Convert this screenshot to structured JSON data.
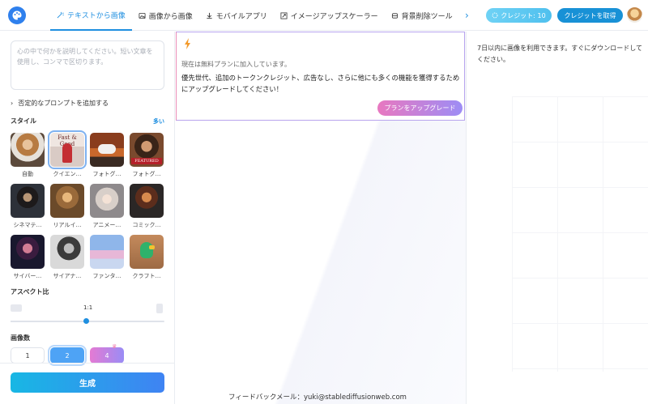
{
  "header": {
    "nav": [
      {
        "label": "テキストから画像",
        "icon": "magic-wand-icon",
        "active": true
      },
      {
        "label": "画像から画像",
        "icon": "image-icon",
        "active": false
      },
      {
        "label": "モバイルアプリ",
        "icon": "download-icon",
        "active": false
      },
      {
        "label": "イメージアップスケーラー",
        "icon": "upscale-icon",
        "active": false
      },
      {
        "label": "背景削除ツール",
        "icon": "layers-icon",
        "active": false
      }
    ],
    "credits": "クレジット: 10",
    "get_credits": "クレジットを取得"
  },
  "left": {
    "prompt_placeholder": "心の中で何かを説明してください。短い文章を使用し、コンマで区切ります。",
    "negative_prompt": "否定的なプロンプトを追加する",
    "style_title": "スタイル",
    "more": "多い",
    "styles": [
      {
        "label": "自動"
      },
      {
        "label": "クイエン…",
        "overlay": "Fast & Good",
        "selected": true
      },
      {
        "label": "フォトグ…"
      },
      {
        "label": "フォトグ…",
        "overlay": "FEATURED"
      },
      {
        "label": "シネマテ…"
      },
      {
        "label": "リアルイ…"
      },
      {
        "label": "アニメー…"
      },
      {
        "label": "コミック…"
      },
      {
        "label": "サイバー…"
      },
      {
        "label": "サイアナ…"
      },
      {
        "label": "ファンタ…"
      },
      {
        "label": "クラフト…"
      }
    ],
    "aspect_title": "アスペクト比",
    "aspect_value": "1:1",
    "aspect_slider_fraction": 0.49,
    "count_title": "画像数",
    "counts": [
      "1",
      "2",
      "4"
    ],
    "selected_count": "2",
    "generate": "生成"
  },
  "middle": {
    "plan_note": "現在は無料プランに加入しています。",
    "upgrade_message": "優先世代、追加のトークンクレジット、広告なし、さらに他にも多くの機能を獲得するためにアップグレードしてください！",
    "upgrade_button": "プランをアップグレード",
    "feedback": "フィードバックメール：yuki@stablediffusionweb.com"
  },
  "right": {
    "note": "7日以内に画像を利用できます。すぐにダウンロードしてください。"
  },
  "colors": {
    "accent": "#1f8fe0",
    "generate_start": "#18b7e4",
    "generate_end": "#3f83f3",
    "upgrade_start": "#e878c0",
    "upgrade_end": "#9d8df5"
  }
}
